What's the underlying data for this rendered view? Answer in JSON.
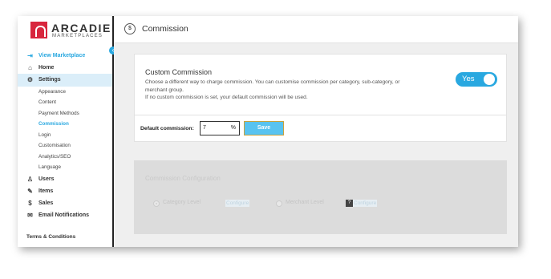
{
  "brand": {
    "name": "ARCADIER",
    "tagline": "MARKETPLACES"
  },
  "header": {
    "title": "Commission",
    "icon": "commission-icon"
  },
  "sidebar": {
    "items": [
      {
        "label": "View Marketplace",
        "icon": "enter-icon"
      },
      {
        "label": "Home",
        "icon": "home-icon"
      },
      {
        "label": "Settings",
        "icon": "gear-icon"
      },
      {
        "label": "Users",
        "icon": "user-icon"
      },
      {
        "label": "Items",
        "icon": "items-icon"
      },
      {
        "label": "Sales",
        "icon": "dollar-icon"
      },
      {
        "label": "Email Notifications",
        "icon": "envelope-icon"
      }
    ],
    "settings_sub": [
      "Appearance",
      "Content",
      "Payment Methods",
      "Commission",
      "Login",
      "Customisation",
      "Analytics/SEO",
      "Language"
    ],
    "footer": "Terms & Conditions"
  },
  "custom_commission": {
    "title": "Custom Commission",
    "description_1": "Choose a different way to charge commission. You can customise commission per category, sub-category, or merchant group.",
    "description_2": "If no custom commission is set, your default commission will be used.",
    "toggle_label": "Yes",
    "toggle_on": true
  },
  "default_commission": {
    "label": "Default commission:",
    "value": "7",
    "unit": "%",
    "save_label": "Save"
  },
  "commission_config": {
    "title": "Commission Configuration",
    "options": [
      {
        "label": "Category Level",
        "link": "Configure",
        "selected": true
      },
      {
        "label": "Merchant Level",
        "link": "Configure",
        "selected": false
      }
    ]
  },
  "colors": {
    "accent": "#29a8e0",
    "brand_red": "#d8263d"
  }
}
